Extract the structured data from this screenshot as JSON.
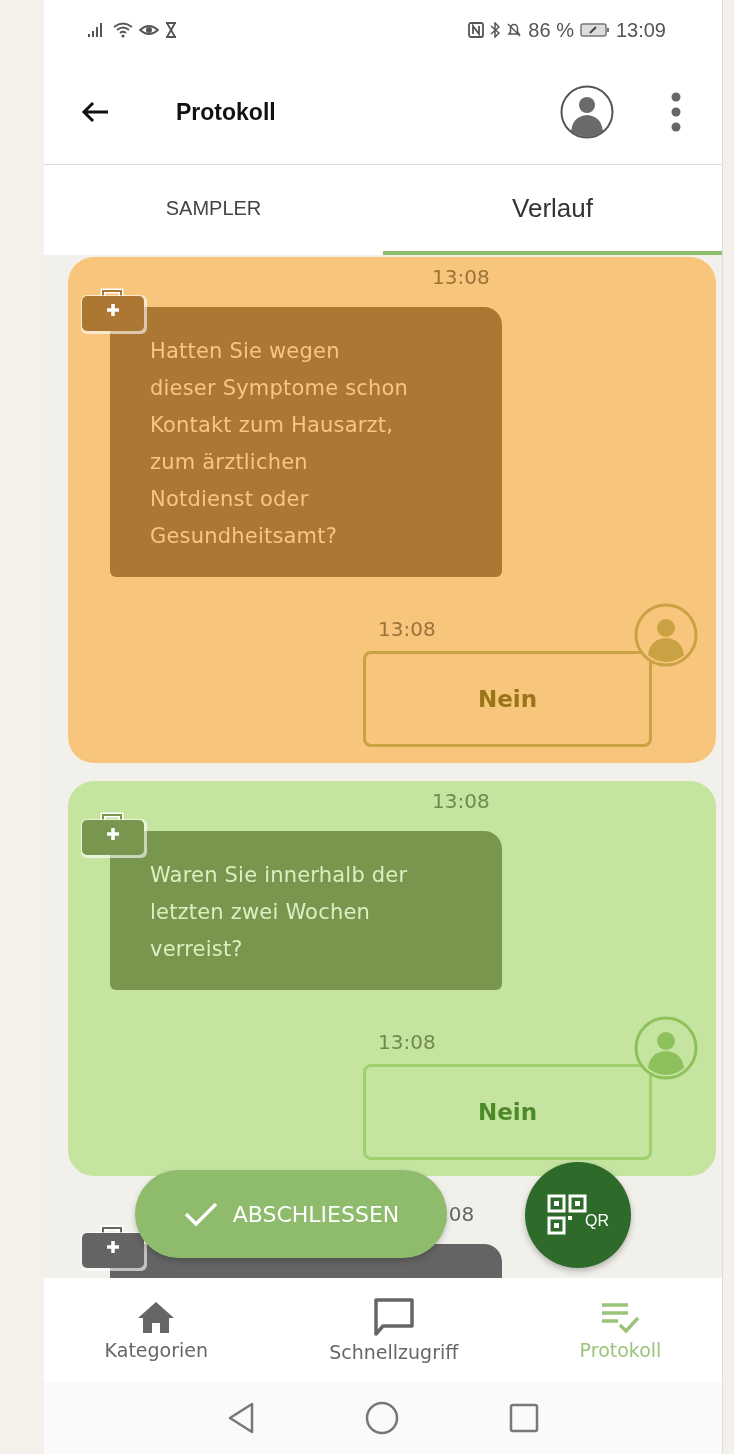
{
  "status_bar": {
    "battery": "86 %",
    "time": "13:09"
  },
  "app_bar": {
    "title": "Protokoll"
  },
  "tabs": [
    {
      "label": "SAMPLER",
      "selected": false
    },
    {
      "label": "Verlauf",
      "selected": true
    }
  ],
  "messages": [
    {
      "kind": "warning",
      "time": "13:08",
      "question": "Hatten Sie wegen dieser Symptome schon Kontakt zum Hausarzt, zum ärztlichen Notdienst oder Gesundheitsamt?",
      "answer_time": "13:08",
      "answer": "Nein"
    },
    {
      "kind": "ok",
      "time": "13:08",
      "question": "Waren Sie innerhalb der letzten zwei Wochen verreist?",
      "answer_time": "13:08",
      "answer": "Nein"
    },
    {
      "kind": "neutral",
      "time": ":08"
    }
  ],
  "finish_button": {
    "label": "ABSCHLIESSEN"
  },
  "qr_button": {
    "label": "QR"
  },
  "bottom_nav": [
    {
      "label": "Kategorien",
      "selected": false
    },
    {
      "label": "Schnellzugriff",
      "selected": false
    },
    {
      "label": "Protokoll",
      "selected": true
    }
  ]
}
